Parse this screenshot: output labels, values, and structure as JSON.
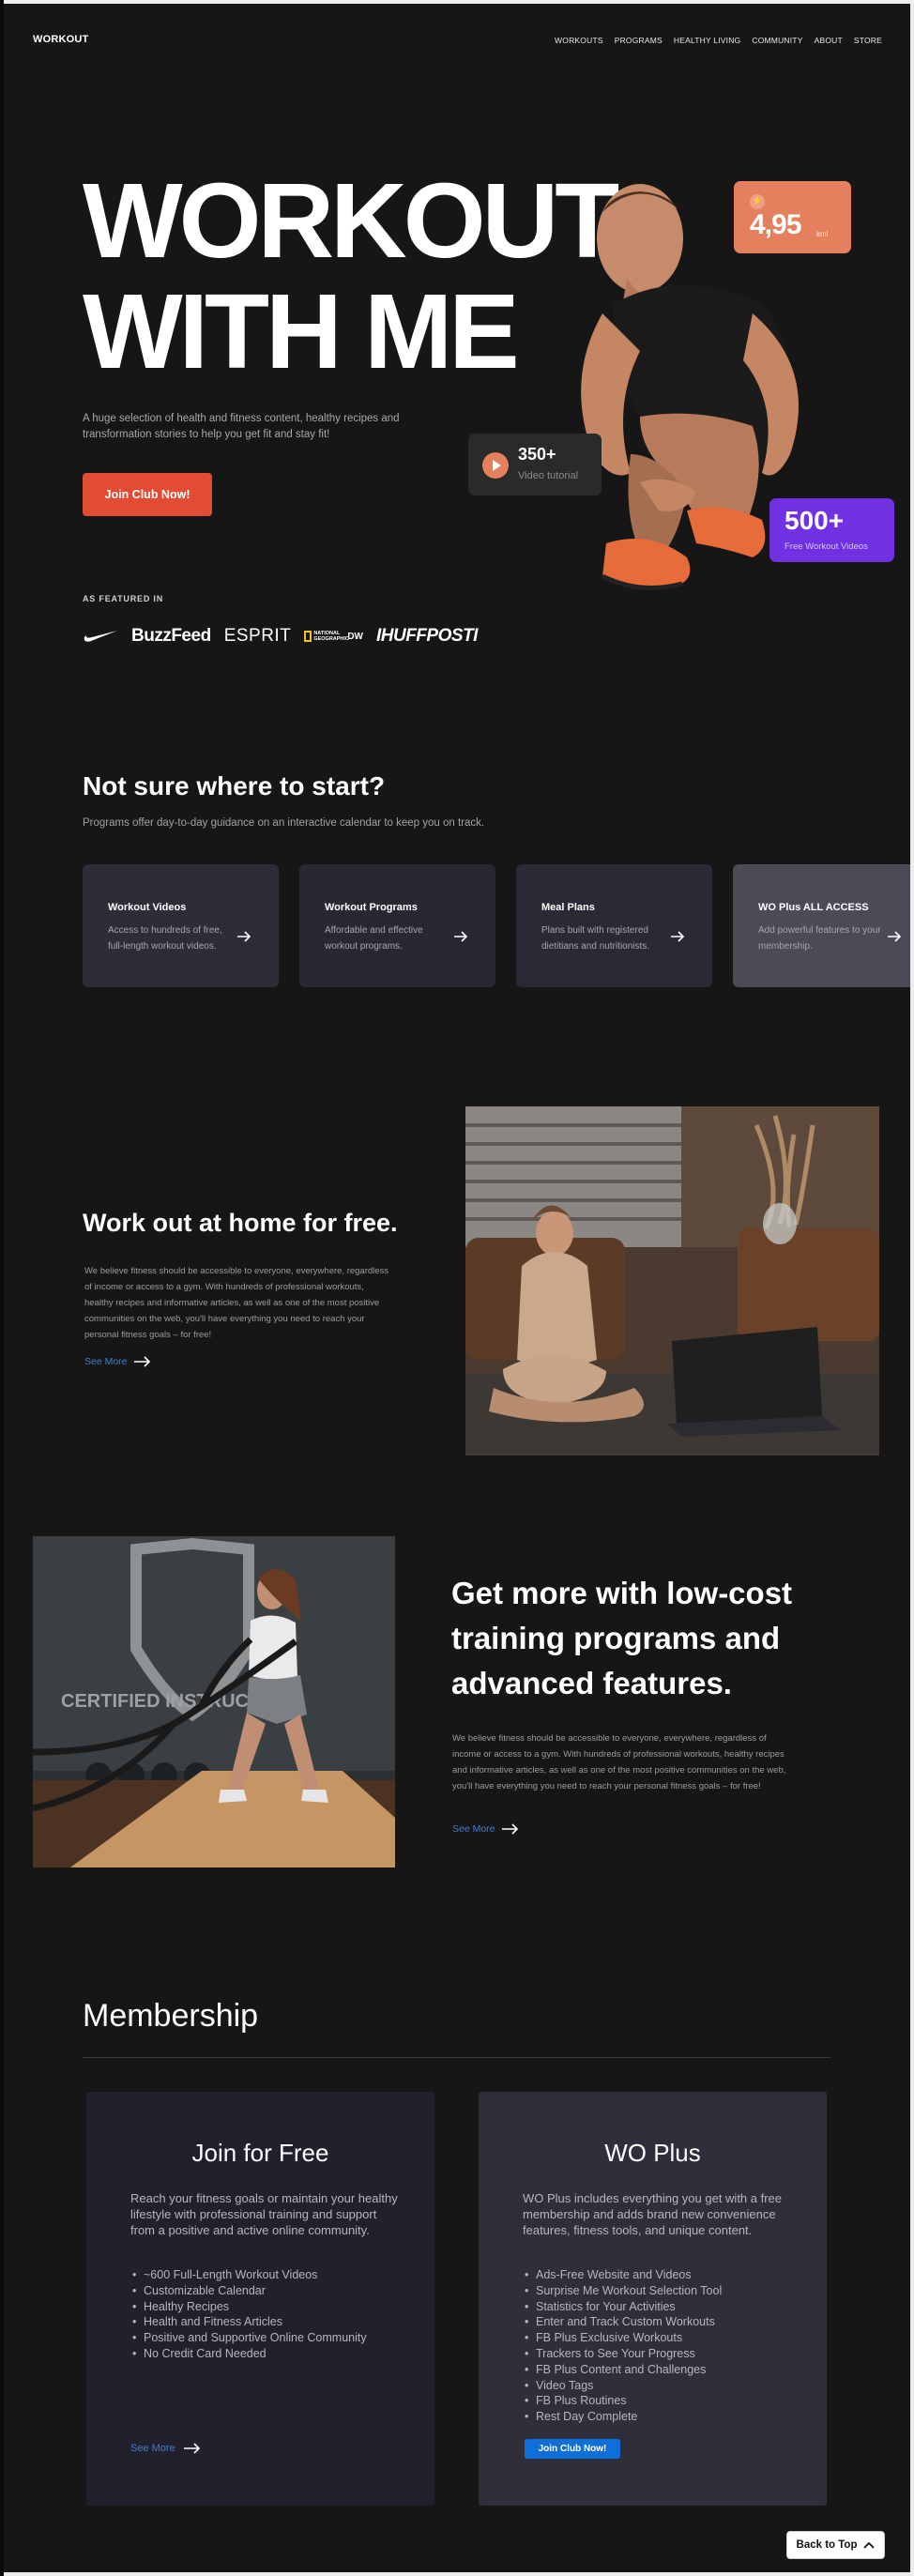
{
  "nav": {
    "logo": "WORKOUT",
    "links": [
      "WORKOUTS",
      "PROGRAMS",
      "HEALTHY LIVING",
      "COMMUNITY",
      "ABOUT",
      "STORE"
    ]
  },
  "hero": {
    "title_line1": "WORKOUT",
    "title_line2": "WITH ME",
    "subtitle": "A huge selection of health and fitness content, healthy recipes and transformation stories to help you get fit and stay fit!",
    "cta": "Join Club Now!",
    "stat_orange": {
      "value": "4,95",
      "unit": "kml",
      "icon": "bolt-icon"
    },
    "stat_video": {
      "value": "350+",
      "label": "Video tutorial"
    },
    "stat_purple": {
      "value": "500+",
      "label": "Free Workout Videos"
    }
  },
  "featured": {
    "label": "AS FEATURED IN",
    "brands": [
      "nike",
      "BuzzFeed",
      "ESPRIT",
      "NATIONAL GEOGRAPHIC",
      "DW",
      "IHUFFPOSTI"
    ]
  },
  "start": {
    "title": "Not sure where to start?",
    "subtitle": "Programs offer day-to-day guidance on an interactive calendar to keep you on track.",
    "cards": [
      {
        "title": "Workout Videos",
        "desc": "Access to hundreds of free, full-length workout videos."
      },
      {
        "title": "Workout Programs",
        "desc": "Affordable and effective workout programs."
      },
      {
        "title": "Meal Plans",
        "desc": "Plans built with registered dietitians and nutritionists."
      },
      {
        "title": "WO Plus ALL ACCESS",
        "desc": "Add powerful features to your membership."
      }
    ]
  },
  "home": {
    "title": "Work out at home for free.",
    "text": "We believe fitness should be accessible to everyone, everywhere, regardless of income or access to a gym. With hundreds of professional workouts, healthy recipes and informative articles, as well as one of the most positive communities on the web, you'll have everything you need to reach your personal fitness goals – for free!",
    "see_more": "See More"
  },
  "more": {
    "title": "Get more with low-cost training programs and advanced features.",
    "text": "We believe fitness should be accessible to everyone, everywhere, regardless of income or access to a gym. With hundreds of professional workouts, healthy recipes and informative articles, as well as one of the most positive communities on the web, you'll have everything you need to reach your personal fitness goals – for free!",
    "see_more": "See More",
    "image_sign": "CERTIFIED INSTRUCT"
  },
  "membership": {
    "title": "Membership",
    "free": {
      "title": "Join for Free",
      "desc": "Reach your fitness goals or maintain your healthy lifestyle with professional training and support from a positive and active online community.",
      "features": [
        "~600 Full-Length Workout Videos",
        "Customizable Calendar",
        "Healthy Recipes",
        "Health and Fitness Articles",
        "Positive and Supportive Online Community",
        "No Credit Card Needed"
      ],
      "see_more": "See More"
    },
    "plus": {
      "title": "WO Plus",
      "desc": "WO Plus includes everything you get with a free membership and adds brand new convenience features, fitness tools, and unique content.",
      "features": [
        "Ads-Free Website and Videos",
        "Surprise Me Workout Selection Tool",
        "Statistics for Your Activities",
        "Enter and Track Custom Workouts",
        "FB Plus Exclusive Workouts",
        "Trackers to See Your Progress",
        "FB Plus Content and Challenges",
        "Video Tags",
        "FB Plus Routines",
        "Rest Day Complete"
      ],
      "cta": "Join Club Now!"
    }
  },
  "back_to_top": "Back to Top",
  "colors": {
    "accent_red": "#e24c32",
    "accent_orange": "#e5805f",
    "accent_purple": "#7230e3",
    "link_blue": "#3c7fd6",
    "button_blue": "#0f6fd8"
  }
}
